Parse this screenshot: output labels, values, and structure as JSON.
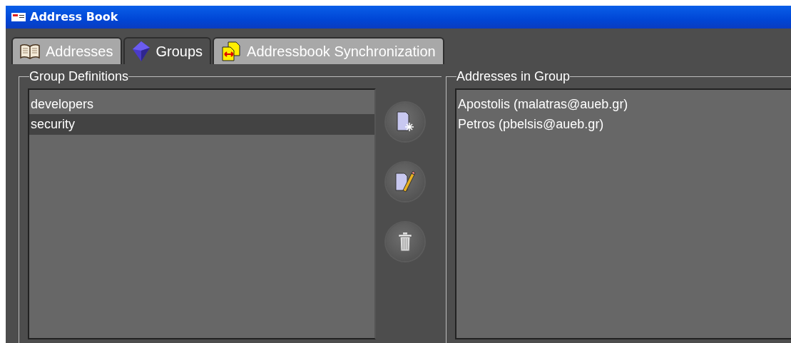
{
  "window": {
    "title": "Address Book"
  },
  "tabs": [
    {
      "label": "Addresses",
      "selected": false,
      "kind": "book"
    },
    {
      "label": "Groups",
      "selected": true,
      "kind": "cube"
    },
    {
      "label": "Addressbook Synchronization",
      "selected": false,
      "kind": "sync"
    }
  ],
  "group_definitions": {
    "title": "Group Definitions",
    "items": [
      {
        "label": "developers",
        "selected": false
      },
      {
        "label": "security",
        "selected": true
      }
    ],
    "buttons": [
      {
        "kind": "new"
      },
      {
        "kind": "edit"
      },
      {
        "kind": "delete"
      }
    ]
  },
  "addresses_in_group": {
    "title": "Addresses in Group",
    "items": [
      {
        "label": "Apostolis (malatras@aueb.gr)",
        "selected": false
      },
      {
        "label": "Petros (pbelsis@aueb.gr)",
        "selected": false
      }
    ]
  }
}
